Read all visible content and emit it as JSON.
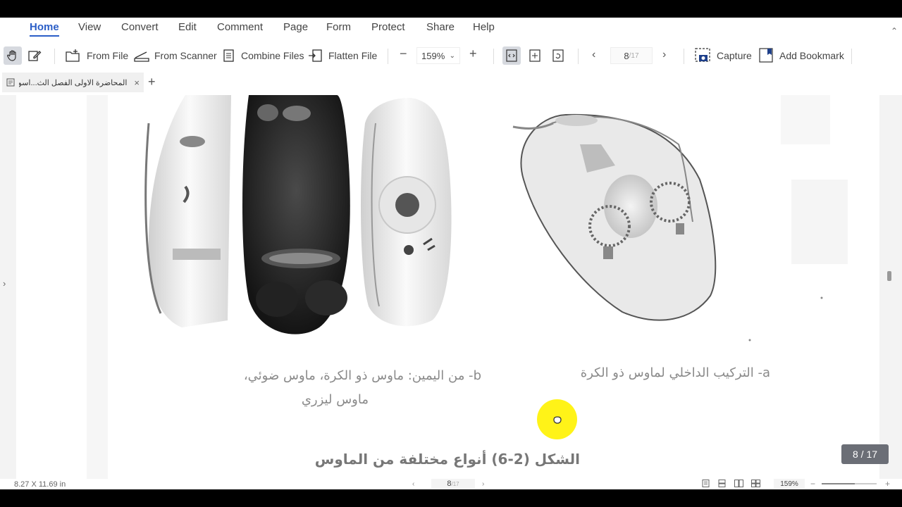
{
  "menu": {
    "items": [
      "Home",
      "View",
      "Convert",
      "Edit",
      "Comment",
      "Page",
      "Form",
      "Protect",
      "Share",
      "Help"
    ],
    "active": "Home"
  },
  "toolbar": {
    "from_file": "From File",
    "from_scanner": "From Scanner",
    "combine_files": "Combine Files",
    "flatten_file": "Flatten File",
    "zoom_minus": "−",
    "zoom_value": "159%",
    "zoom_plus": "+",
    "prev_page": "‹",
    "current_page": "8",
    "total_pages": "/17",
    "next_page": "›",
    "capture": "Capture",
    "add_bookmark": "Add Bookmark"
  },
  "tabs": [
    {
      "title": "المحاضرة الاولى الفصل الث...اسوب"
    }
  ],
  "document": {
    "caption_right": "a- التركيب الداخلي لماوس ذو الكرة",
    "caption_left_line1": "b- من اليمين: ماوس ذو الكرة، ماوس ضوئي،",
    "caption_left_line2": "ماوس ليزري",
    "figure_title": "الشكل (2-6) أنواع مختلفة من الماوس"
  },
  "page_indicator": "8 / 17",
  "status": {
    "dimensions": "8.27 X 11.69 in",
    "current_page": "8",
    "total_pages": "/17",
    "zoom": "159%",
    "zoom_minus": "−",
    "zoom_plus": "+",
    "zoom_fraction": 0.6
  },
  "colors": {
    "accent": "#2b5ec7",
    "cursor_highlight": "#fff200",
    "badge": "#6b6e76"
  }
}
